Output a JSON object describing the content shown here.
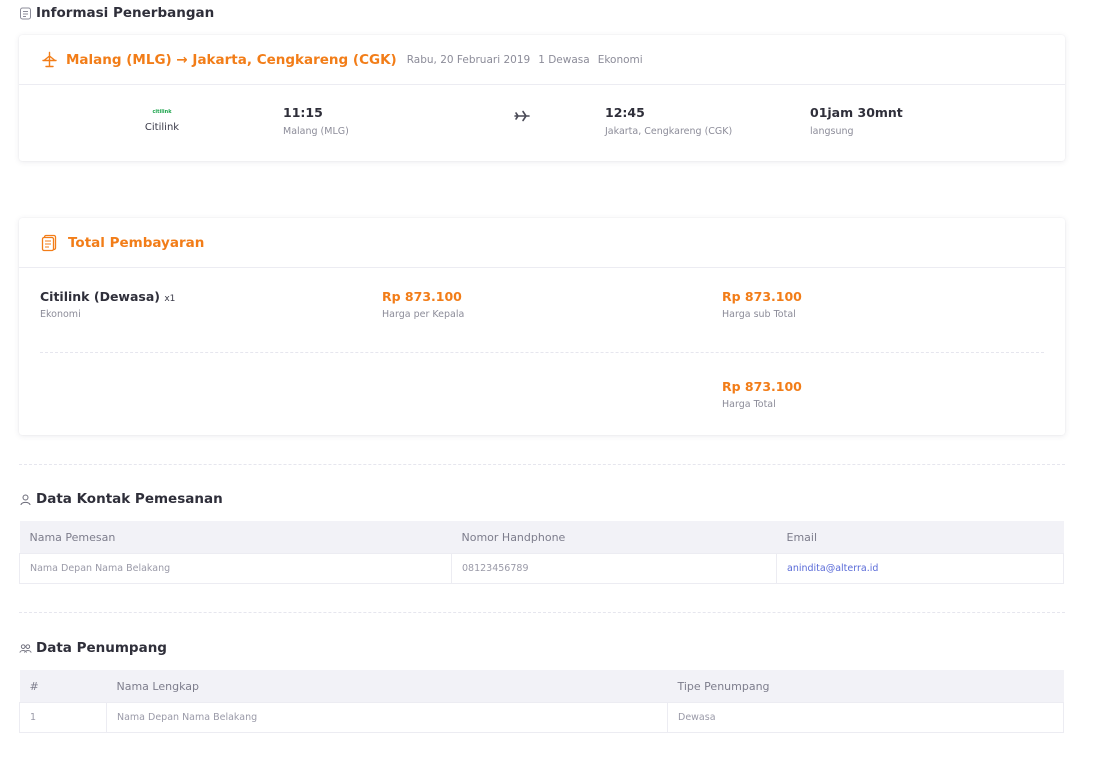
{
  "flight_section": {
    "title": "Informasi Penerbangan"
  },
  "flight": {
    "route": "Malang (MLG) → Jakarta, Cengkareng (CGK)",
    "date": "Rabu, 20 Februari 2019",
    "passengers": "1 Dewasa",
    "class": "Ekonomi",
    "airline_logo_text": "citilink",
    "airline": "Citilink",
    "depart_time": "11:15",
    "depart_city": "Malang (MLG)",
    "arrive_time": "12:45",
    "arrive_city": "Jakarta, Cengkareng (CGK)",
    "duration": "01jam 30mnt",
    "stops": "langsung"
  },
  "payment": {
    "title": "Total Pembayaran",
    "item_name": "Citilink (Dewasa)",
    "item_qty": "x1",
    "item_class": "Ekonomi",
    "price_per_head": "Rp 873.100",
    "price_per_head_label": "Harga per Kepala",
    "subtotal": "Rp 873.100",
    "subtotal_label": "Harga sub Total",
    "total": "Rp 873.100",
    "total_label": "Harga Total"
  },
  "contact": {
    "title": "Data Kontak Pemesanan",
    "headers": [
      "Nama Pemesan",
      "Nomor Handphone",
      "Email"
    ],
    "row": [
      "Nama Depan Nama Belakang",
      "08123456789",
      "anindita@alterra.id"
    ]
  },
  "passengers": {
    "title": "Data Penumpang",
    "headers": [
      "#",
      "Nama Lengkap",
      "Tipe Penumpang"
    ],
    "rows": [
      [
        "1",
        "Nama Depan Nama Belakang",
        "Dewasa"
      ]
    ]
  },
  "colors": {
    "accent": "#f27d18",
    "link": "#5a6bd8",
    "table_header": "#f2f2f7"
  },
  "icons": {
    "flight_section": "document-icon",
    "route": "airplane-icon",
    "direction": "plane-right-icon",
    "payment": "receipt-icon",
    "contact": "user-icon",
    "passengers": "users-icon"
  }
}
